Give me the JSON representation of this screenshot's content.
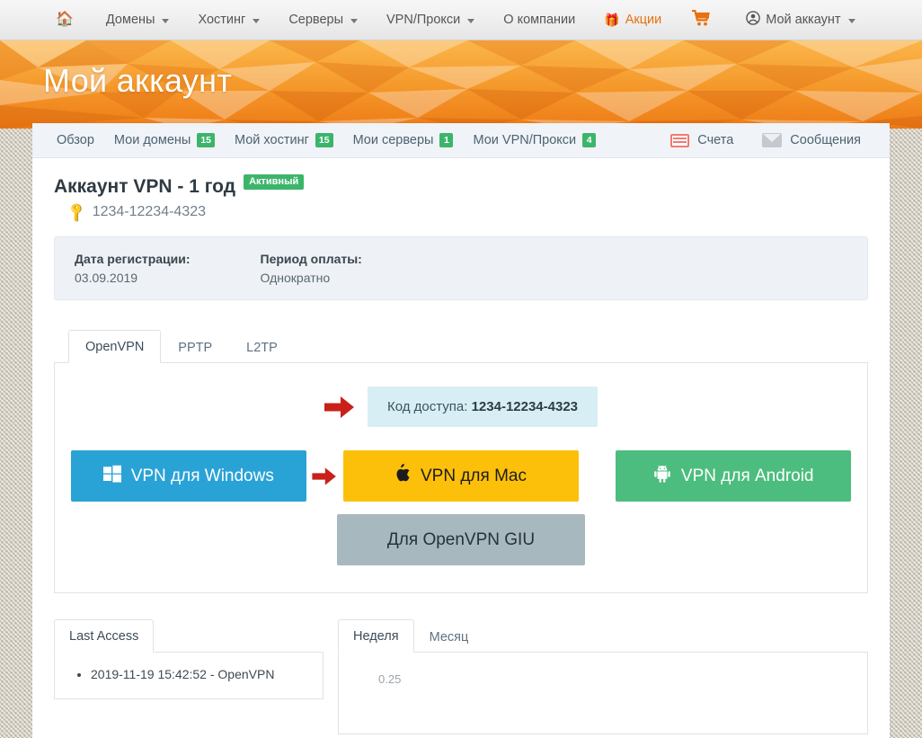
{
  "topnav": {
    "home_icon": "home-icon",
    "items": [
      {
        "label": "Домены",
        "caret": true
      },
      {
        "label": "Хостинг",
        "caret": true
      },
      {
        "label": "Серверы",
        "caret": true
      },
      {
        "label": "VPN/Прокси",
        "caret": true
      },
      {
        "label": "О компании",
        "caret": false
      }
    ],
    "promo": {
      "label": "Акции",
      "icon": "gift-icon",
      "color": "#e8700f"
    },
    "cart_icon": "cart-icon",
    "account": {
      "label": "Мой аккаунт",
      "icon": "user-circle-icon",
      "caret": true
    }
  },
  "banner": {
    "title": "Мой аккаунт",
    "color_light": "#fbb040",
    "color_dark": "#ef7d18"
  },
  "account_tabs": {
    "items": [
      {
        "label": "Обзор",
        "badge": ""
      },
      {
        "label": "Мои домены",
        "badge": "15"
      },
      {
        "label": "Мой хостинг",
        "badge": "15"
      },
      {
        "label": "Мои серверы",
        "badge": "1"
      },
      {
        "label": "Мои VPN/Прокси",
        "badge": "4"
      }
    ],
    "right": [
      {
        "label": "Счета",
        "icon": "invoice-card-icon"
      },
      {
        "label": "Сообщения",
        "icon": "envelope-icon"
      }
    ],
    "badge_color": "#3cb56b"
  },
  "account": {
    "title": "Аккаунт VPN - 1 год",
    "status": "Активный",
    "status_color": "#3cb56b",
    "id": "1234-12234-4323",
    "id_icon": "key-icon",
    "info": [
      {
        "label": "Дата регистрации:",
        "value": "03.09.2019"
      },
      {
        "label": "Период оплаты:",
        "value": "Однократно"
      }
    ]
  },
  "protocol": {
    "tabs": [
      {
        "label": "OpenVPN",
        "active": true
      },
      {
        "label": "PPTP",
        "active": false
      },
      {
        "label": "L2TP",
        "active": false
      }
    ],
    "access_code_label": "Код доступа:",
    "access_code_value": "1234-12234-4323",
    "arrow_icon": "arrow-right-icon",
    "arrow_color": "#c9201a",
    "buttons": [
      {
        "label": "VPN для Windows",
        "icon": "windows-icon",
        "bg": "#29a3d6",
        "fg": "#ffffff"
      },
      {
        "label": "VPN для Mac",
        "icon": "apple-icon",
        "bg": "#fdc00a",
        "fg": "#1c1c1c"
      },
      {
        "label": "VPN для Android",
        "icon": "android-icon",
        "bg": "#4cbd7e",
        "fg": "#ffffff"
      }
    ],
    "gui_button": {
      "label": "Для OpenVPN GIU",
      "bg": "#a8b8bf",
      "fg": "#26333a"
    }
  },
  "last_access": {
    "tab_label": "Last Access",
    "entries": [
      "2019-11-19 15:42:52 - OpenVPN"
    ]
  },
  "usage_chart": {
    "tabs": [
      {
        "label": "Неделя",
        "active": true
      },
      {
        "label": "Месяц",
        "active": false
      }
    ],
    "chart_data": {
      "type": "line",
      "title": "",
      "xlabel": "",
      "ylabel": "",
      "categories": [],
      "values": [],
      "ylim": [
        0,
        0.25
      ],
      "yticks": [
        "0.25"
      ],
      "grid": true,
      "legend": "none"
    }
  }
}
